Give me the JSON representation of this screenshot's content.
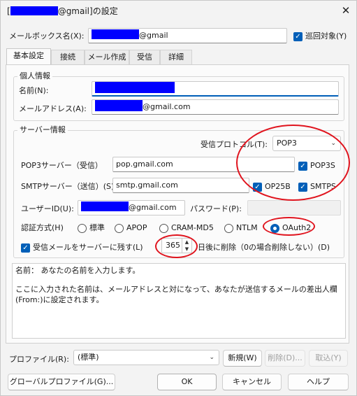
{
  "title": {
    "redacted": "█████",
    "suffix": "@gmail]の設定",
    "prefix": "["
  },
  "mailbox": {
    "label": "メールボックス名(X):",
    "value_suffix": "@gmail",
    "cycle_label": "巡回対象(Y)"
  },
  "tabs": [
    {
      "label": "基本設定"
    },
    {
      "label": "接続"
    },
    {
      "label": "メール作成"
    },
    {
      "label": "受信"
    },
    {
      "label": "詳細"
    }
  ],
  "personal": {
    "group_label": "個人情報",
    "name_label": "名前(N):",
    "email_label": "メールアドレス(A):",
    "email_suffix": "@gmail.com"
  },
  "server": {
    "group_label": "サーバー情報",
    "protocol_label": "受信プロトコル(T):",
    "protocol_value": "POP3",
    "pop3_label": "POP3サーバー（受信）",
    "pop3_value": "pop.gmail.com",
    "pop3s_label": "POP3S",
    "smtp_label": "SMTPサーバー（送信）(S):",
    "smtp_value": "smtp.gmail.com",
    "op25b_label": "OP25B",
    "smtps_label": "SMTPS",
    "userid_label": "ユーザーID(U):",
    "userid_suffix": "@gmail.com",
    "password_label": "パスワード(P):"
  },
  "auth": {
    "label": "認証方式(H)",
    "options": [
      "標準",
      "APOP",
      "CRAM-MD5",
      "NTLM",
      "OAuth2"
    ],
    "selected": "OAuth2"
  },
  "retention": {
    "checkbox_label": "受信メールをサーバーに残す(L)",
    "days": "365",
    "suffix_label": "日後に削除（0の場合削除しない）(D)"
  },
  "description": {
    "line1": "名前： あなたの名前を入力します。",
    "line2": "ここに入力された名前は、メールアドレスと対になって、あなたが送信するメールの差出人欄(From:)に設定されます。"
  },
  "profile": {
    "label": "プロファイル(R):",
    "value": "(標準)",
    "new_label": "新規(W)",
    "delete_label": "削除(D)...",
    "import_label": "取込(Y)"
  },
  "buttons": {
    "global_profile": "グローバルプロファイル(G)...",
    "ok": "OK",
    "cancel": "キャンセル",
    "help": "ヘルプ"
  },
  "colors": {
    "accent": "#005fb8",
    "redaction": "#0000ff",
    "annotation": "#e0141e"
  },
  "icons": {
    "close": "close-icon",
    "check": "check-icon",
    "chevron": "chevron-down-icon"
  }
}
